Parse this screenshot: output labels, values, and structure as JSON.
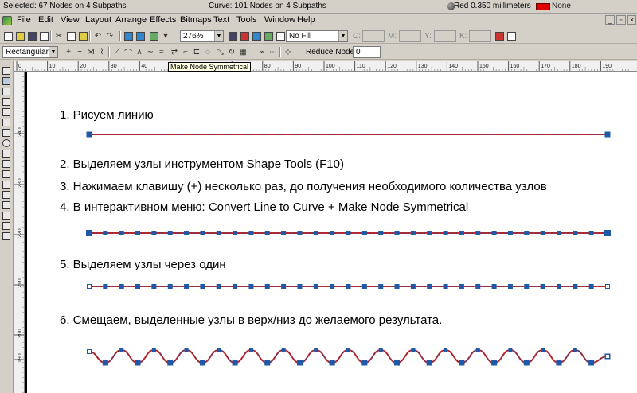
{
  "status": {
    "selection": "Selected: 67 Nodes on 4 Subpaths",
    "curve": "Curve: 101 Nodes on 4 Subpaths",
    "outline": "Red  0.350 millimeters",
    "fill": "None",
    "fill_color": "#e00000"
  },
  "menu": [
    "File",
    "Edit",
    "View",
    "Layout",
    "Arrange",
    "Effects",
    "Bitmaps",
    "Text",
    "Tools",
    "Window",
    "Help"
  ],
  "toolbar": {
    "zoom": "276%",
    "fill_select": "No Fill",
    "c_label": "C:",
    "m_label": "M:",
    "y_label": "Y:",
    "k_label": "K:",
    "shape_mode": "Rectangular",
    "reduce_nodes_label": "Reduce Nodes",
    "reduce_nodes_value": "0"
  },
  "tooltip": "Make Node Symmetrical",
  "ruler": {
    "h_labels": [
      "0",
      "10",
      "20",
      "30",
      "40",
      "50",
      "60",
      "70",
      "80",
      "90",
      "100",
      "110",
      "120",
      "130",
      "140",
      "150",
      "160",
      "170",
      "180",
      "190"
    ],
    "v_labels": [
      "240",
      "230",
      "220",
      "210",
      "200",
      "190"
    ]
  },
  "steps": [
    "1. Рисуем линию",
    "2. Выделяем узлы инструментом Shape Tools (F10)",
    "3. Нажимаем клавишу (+) несколько раз, до получения необходимого количества узлов",
    "4. В интерактивном меню:  Convert Line to Curve + Make Node Symmetrical",
    "5. Выделяем узлы через один",
    "6. Смещаем, выделенные узлы в верх/низ до желаемого результата."
  ],
  "colors": {
    "line": "#c0282d",
    "node": "#1e5aa8"
  }
}
